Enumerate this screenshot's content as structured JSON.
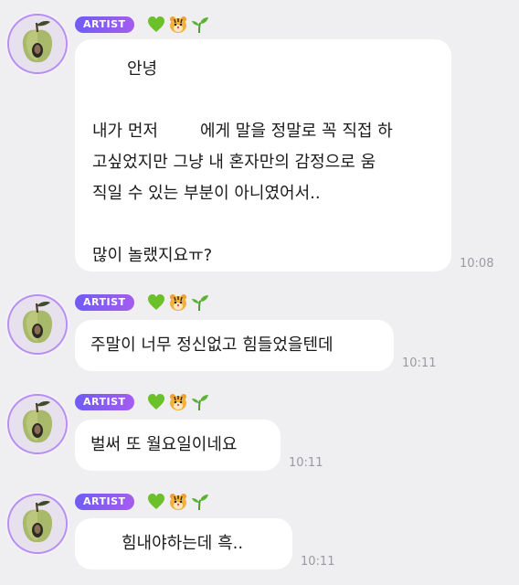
{
  "messages": [
    {
      "badge": "ARTIST",
      "emojis": [
        "green-heart",
        "tiger-face",
        "seedling"
      ],
      "lines": [
        {
          "pre": "",
          "post": "안녕"
        },
        {
          "pre": "",
          "post": ""
        },
        {
          "pre": "내가 먼저",
          "post": "에게 말을 정말로 꼭 직접 하"
        },
        {
          "pre": "",
          "post": "고싶었지만 그냥 내 혼자만의 감정으로 움"
        },
        {
          "pre": "",
          "post": "직일 수 있는 부분이 아니였어서.."
        },
        {
          "pre": "",
          "post": ""
        },
        {
          "pre": "",
          "post": "많이 놀랬지요ㅠ?"
        }
      ],
      "time": "10:08"
    },
    {
      "badge": "ARTIST",
      "emojis": [
        "green-heart",
        "tiger-face",
        "seedling"
      ],
      "lines": [
        {
          "pre": "",
          "post": "주말이 너무 정신없고 힘들었을텐데"
        }
      ],
      "time": "10:11"
    },
    {
      "badge": "ARTIST",
      "emojis": [
        "green-heart",
        "tiger-face",
        "seedling"
      ],
      "lines": [
        {
          "pre": "",
          "post": "벌써 또 월요일이네요"
        }
      ],
      "time": "10:11"
    },
    {
      "badge": "ARTIST",
      "emojis": [
        "green-heart",
        "tiger-face",
        "seedling"
      ],
      "lines": [
        {
          "pre": "",
          "post": "힘내야하는데 흑.."
        }
      ],
      "time": "10:11"
    }
  ],
  "colors": {
    "background": "#efeff1",
    "bubble": "#ffffff",
    "badge_start": "#6f5cf5",
    "badge_end": "#a55cf0",
    "timestamp": "#9a9aa2"
  }
}
